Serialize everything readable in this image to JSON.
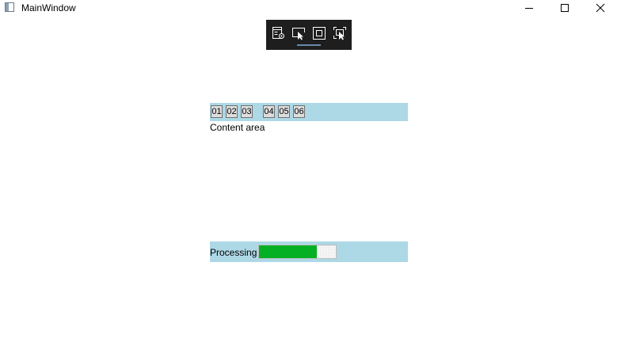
{
  "window": {
    "title": "MainWindow",
    "icon": "app-window-icon",
    "controls": [
      "minimize-icon",
      "maximize-icon",
      "close-icon"
    ]
  },
  "debug_toolbar": {
    "tools": [
      "live-visual-tree-icon",
      "select-element-icon",
      "display-layout-adorners-icon",
      "track-focused-element-icon"
    ]
  },
  "tabs": [
    {
      "label": "01"
    },
    {
      "label": "02"
    },
    {
      "label": "03"
    },
    {
      "label": "04"
    },
    {
      "label": "05"
    },
    {
      "label": "06"
    }
  ],
  "content": {
    "label": "Content area"
  },
  "status": {
    "text": "Processing",
    "progress_percent": 75,
    "progress_color": "#06b025"
  },
  "colors": {
    "panel_background": "#add8e6",
    "toolbar_background": "#1e1e1e"
  }
}
